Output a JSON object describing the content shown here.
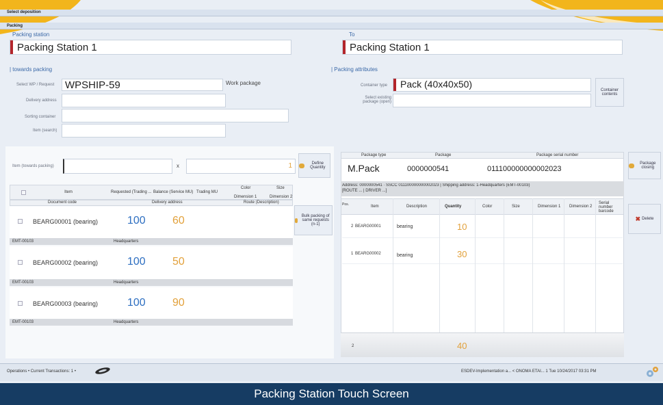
{
  "header": {
    "select_deposition": "Select deposition",
    "packing_section": "Packing"
  },
  "from": {
    "title": "Packing station",
    "value": "Packing Station 1"
  },
  "to": {
    "title": "To",
    "value": "Packing Station 1"
  },
  "towards_packing": {
    "section": "| towards packing",
    "select_wp_label": "Select WP / Request",
    "select_wp_value": "WPSHIP-59",
    "work_package_label": "Work package",
    "delivery_address_label": "Delivery address",
    "sorting_container_label": "Sorting container",
    "item_search_label": "Item (search)"
  },
  "packing_attributes": {
    "section": "| Packing attributes",
    "container_type_label": "Container type",
    "container_type_value": "Pack (40x40x50)",
    "select_existing_label": "Select existing package (open)",
    "container_contents_button": "Container contents"
  },
  "item_entry": {
    "label": "Item (towards packing)",
    "x_sign": "x",
    "quantity": "1",
    "define_quantity_button": "Define Quantity",
    "bulk_packing_button": "Bulk packing of same requests (n-1)"
  },
  "left_table": {
    "columns": {
      "item": "Item",
      "requested": "Requested (Trading ...",
      "balance": "Balance (Service MU)",
      "trading_mu": "Trading MU",
      "color": "Color",
      "size": "Size",
      "dimension1": "Dimension 1",
      "dimension2": "Dimension 2",
      "document_code": "Document code",
      "delivery_address": "Delivery address",
      "route": "Route (Description)"
    },
    "rows": [
      {
        "item": "BEARG00001 (bearing)",
        "requested": "100",
        "balance": "60",
        "doc": "EMT-00103",
        "addr": "Headquarters"
      },
      {
        "item": "BEARG00002 (bearing)",
        "requested": "100",
        "balance": "50",
        "doc": "EMT-00103",
        "addr": "Headquarters"
      },
      {
        "item": "BEARG00003 (bearing)",
        "requested": "100",
        "balance": "90",
        "doc": "EMT-00103",
        "addr": "Headquarters"
      }
    ]
  },
  "package_panel": {
    "col_type": "Package type",
    "col_package": "Package",
    "col_serial": "Package serial number",
    "type": "M.Pack",
    "package": "0000000541",
    "serial": "011100000000002023",
    "closing_button": "Package closing",
    "info_line1": "Address: 0000000541 · SSCC 011100000000002023 | Shipping address: 1-Headquarters (EMT-00103)",
    "info_line2": "[ROUTE ... | DRIVER ...]"
  },
  "right_table": {
    "columns": {
      "pos": "Pos.",
      "item": "Item",
      "description": "Description",
      "quantity": "Quantity",
      "color": "Color",
      "size": "Size",
      "dimension1": "Dimension 1",
      "dimension2": "Dimension 2",
      "serial": "Serial number barcode"
    },
    "rows": [
      {
        "pos": "2",
        "item": "BEARG00001",
        "description": "bearing",
        "quantity": "10"
      },
      {
        "pos": "1",
        "item": "BEARG00002",
        "description": "bearing",
        "quantity": "30"
      }
    ],
    "total_pos": "2",
    "total_quantity": "40",
    "delete_button": "Delete"
  },
  "status_bar": {
    "left": "Operations • Current Transactions: 1 •",
    "right": "ESDEV-Implementation a...  < ONOMA ETAI...  1  Tue 10/24/2017  03:31 PM"
  },
  "caption": "Packing Station Touch Screen",
  "colors": {
    "accent_red": "#b3262c",
    "number_blue": "#2e6fc1",
    "number_orange": "#e2a13b",
    "banner": "#163c63",
    "gold_swoosh": "#f2b51c"
  }
}
